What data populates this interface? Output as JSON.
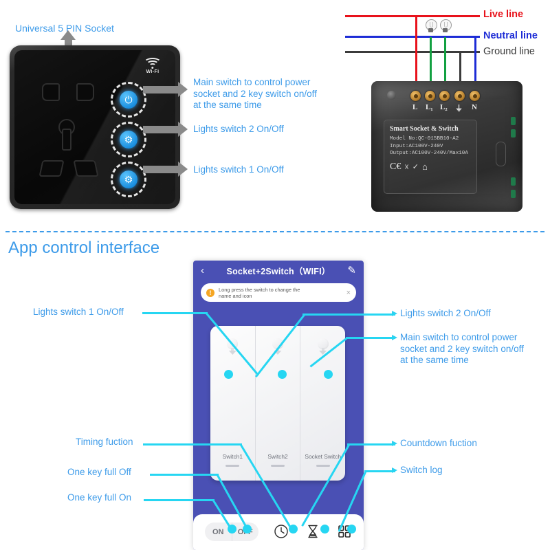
{
  "top_section": {
    "socket_caption": "Universal 5 PIN Socket",
    "device": {
      "wifi_label": "Wi-Fi",
      "buttons": [
        {
          "name": "main-switch",
          "icon": "power-icon"
        },
        {
          "name": "lights-switch-2",
          "icon": "bulb-gear-icon"
        },
        {
          "name": "lights-switch-1",
          "icon": "bulb-gear-icon"
        }
      ]
    },
    "annotations": [
      {
        "text": "Main switch to control power\nsocket and 2 key switch on/off\nat the same time"
      },
      {
        "text": "Lights switch 2 On/Off"
      },
      {
        "text": "Lights switch 1 On/Off"
      }
    ]
  },
  "wiring": {
    "lines": [
      {
        "label": "Live line",
        "color": "#e8121b"
      },
      {
        "label": "Neutral line",
        "color": "#1d2cd6"
      },
      {
        "label": "Ground line",
        "color": "#3b3b3b"
      }
    ],
    "bulbs": 2,
    "terminals": [
      {
        "label": "L",
        "wire_color": "#e8121b"
      },
      {
        "label": "L₁",
        "wire_color": "#12a041"
      },
      {
        "label": "L₂",
        "wire_color": "#12a041"
      },
      {
        "label": "⏚",
        "wire_color": "#3b3b3b"
      },
      {
        "label": "N",
        "wire_color": "#1d2cd6"
      }
    ],
    "spec_plate": {
      "title": "Smart Socket & Switch",
      "lines": [
        "Model  No:QC-015BB10-A2",
        "Input:AC100V-240V",
        "Output:AC100V-240V/Max10A"
      ],
      "certs": [
        "CE",
        "WEEE",
        "RoHS",
        "House"
      ]
    }
  },
  "app_section": {
    "title": "App control interface",
    "phone": {
      "header": {
        "back_icon": "chevron-left-icon",
        "title": "Socket+2Switch（WIFI）",
        "edit_icon": "pencil-icon"
      },
      "notice": {
        "icon": "warning-icon",
        "text": "Long press the switch to change the\nname and icon",
        "close": "×"
      },
      "switches": [
        {
          "name": "Switch1"
        },
        {
          "name": "Switch2"
        },
        {
          "name": "Socket Switch"
        }
      ],
      "toolbar": {
        "on_label": "ON",
        "off_label": "OFF",
        "icons": [
          "clock-icon",
          "hourglass-icon",
          "grid-icon"
        ]
      }
    },
    "annotations_left": [
      {
        "text": "Lights switch 1 On/Off"
      },
      {
        "text": "Timing fuction"
      },
      {
        "text": "One key full Off"
      },
      {
        "text": "One key full On"
      }
    ],
    "annotations_right": [
      {
        "text": "Lights switch 2 On/Off"
      },
      {
        "text": "Main switch to control power\nsocket and 2 key switch on/off\nat the same time"
      },
      {
        "text": "Countdown fuction"
      },
      {
        "text": "Switch log"
      }
    ]
  },
  "colors": {
    "accent_blue": "#3d9be9",
    "cyan": "#26d6f2",
    "phone_bg": "#4a50b4",
    "live": "#e8121b",
    "neutral": "#1d2cd6",
    "ground": "#3b3b3b",
    "earth_green": "#12a041"
  }
}
